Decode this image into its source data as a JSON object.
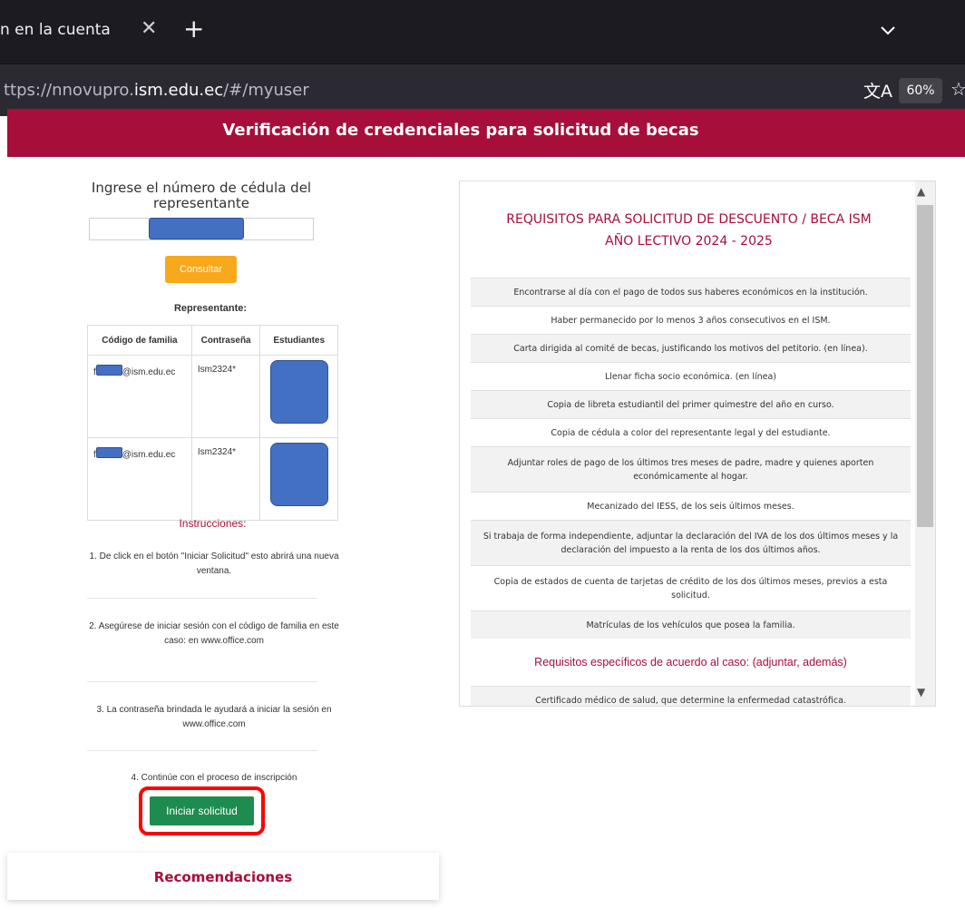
{
  "browser": {
    "tab_title": "n en la cuenta",
    "tab_close_icon": "close-icon",
    "new_tab_icon": "plus-icon",
    "tab_list_icon": "chevron-down-icon",
    "url_prefix": "ttps://nnovupro.",
    "url_domain": "ism.edu.ec",
    "url_path": "/#/myuser",
    "translate_icon": "translate-icon",
    "zoom_level": "60%",
    "bookmark_icon": "star-icon"
  },
  "banner": {
    "title": "Verificación de credenciales para solicitud de becas"
  },
  "left": {
    "prompt": "Ingrese el número de cédula del representante",
    "consultar_label": "Consultar",
    "representative_title": "Representante:",
    "table": {
      "headers": [
        "Código de familia",
        "Contraseña",
        "Estudiantes"
      ],
      "rows": [
        {
          "code_prefix": "f",
          "code_suffix": "@ism.edu.ec",
          "password": "Ism2324*"
        },
        {
          "code_prefix": "f",
          "code_suffix": "@ism.edu.ec",
          "password": "Ism2324*"
        }
      ]
    },
    "instructions_title": "Instrucciones:",
    "instructions": [
      "1. De click en el botón \"Iniciar Solicitud\" esto abrirá una nueva ventana.",
      "2. Asegúrese de iniciar sesión con el código de familia en este caso: en www.office.com",
      "3. La contraseña brindada le ayudará a iniciar la sesión en www.office.com",
      "4. Continúe con el proceso de inscripción"
    ],
    "start_button": "Iniciar solicitud",
    "recommendations": "Recomendaciones"
  },
  "requirements": {
    "title_line1": "REQUISITOS PARA SOLICITUD DE DESCUENTO / BECA ISM",
    "title_line2": "AÑO LECTIVO 2024 - 2025",
    "items": [
      "Encontrarse al día con el pago de todos sus haberes económicos en la institución.",
      "Haber permanecido por lo menos 3 años consecutivos en el ISM.",
      "Carta dirigida al comité de becas, justificando los motivos del petitorio. (en línea).",
      "Llenar ficha socio económica. (en línea)",
      "Copia de libreta estudiantil del primer quimestre del año en curso.",
      "Copia de cédula a color del representante legal y del estudiante.",
      "Adjuntar roles de pago de los últimos tres meses de padre, madre y quienes aporten económicamente al hogar.",
      "Mecanizado del IESS, de los seis últimos meses.",
      "Si trabaja de forma independiente, adjuntar la declaración del IVA de los dos últimos meses y la declaración del impuesto a la renta de los dos últimos años.",
      "Copia de estados de cuenta de tarjetas de crédito de los dos últimos meses, previos a esta solicitud.",
      "Matrículas de los vehículos que posea la familia."
    ],
    "specific_title": "Requisitos específicos de acuerdo al caso: (adjuntar, además)",
    "specific_items": [
      "Certificado médico de salud, que determine la enfermedad catastrófica."
    ]
  }
}
